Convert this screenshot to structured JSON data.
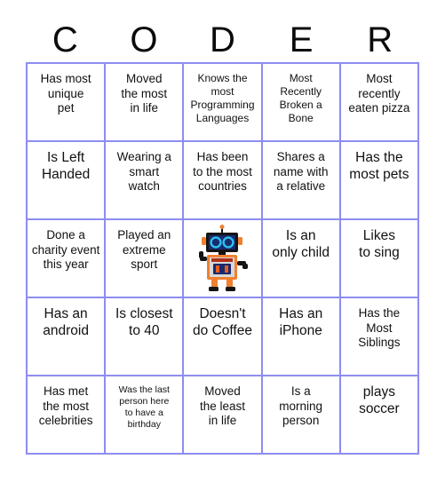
{
  "header": {
    "letters": [
      "C",
      "O",
      "D",
      "E",
      "R"
    ]
  },
  "grid": {
    "border_color": "#8d8df2",
    "rows": 5,
    "columns": 5,
    "cells": [
      {
        "text": "Has most\nunique\npet",
        "size": "md"
      },
      {
        "text": "Moved\nthe most\nin life",
        "size": "md"
      },
      {
        "text": "Knows the\nmost\nProgramming\nLanguages",
        "size": "sm"
      },
      {
        "text": "Most\nRecently\nBroken a\nBone",
        "size": "sm"
      },
      {
        "text": "Most\nrecently\neaten pizza",
        "size": "md"
      },
      {
        "text": "Is Left\nHanded",
        "size": "lg"
      },
      {
        "text": "Wearing a\nsmart\nwatch",
        "size": "md"
      },
      {
        "text": "Has been\nto the most\ncountries",
        "size": "md"
      },
      {
        "text": "Shares a\nname with\na relative",
        "size": "md"
      },
      {
        "text": "Has the\nmost pets",
        "size": "lg"
      },
      {
        "text": "Done a\ncharity event\nthis year",
        "size": "md"
      },
      {
        "text": "Played an\nextreme\nsport",
        "size": "md"
      },
      {
        "text": "",
        "size": "md",
        "icon": "robot-free-space-icon"
      },
      {
        "text": "Is an\nonly child",
        "size": "lg"
      },
      {
        "text": "Likes\nto sing",
        "size": "lg"
      },
      {
        "text": "Has an\nandroid",
        "size": "lg"
      },
      {
        "text": "Is closest\nto 40",
        "size": "lg"
      },
      {
        "text": "Doesn't\ndo Coffee",
        "size": "lg"
      },
      {
        "text": "Has an\niPhone",
        "size": "lg"
      },
      {
        "text": "Has the\nMost\nSiblings",
        "size": "md"
      },
      {
        "text": "Has met\nthe most\ncelebrities",
        "size": "md"
      },
      {
        "text": "Was the last\nperson here\nto have a\nbirthday",
        "size": "xs"
      },
      {
        "text": "Moved\nthe least\nin life",
        "size": "md"
      },
      {
        "text": "Is a\nmorning\nperson",
        "size": "md"
      },
      {
        "text": "plays\nsoccer",
        "size": "lg"
      }
    ]
  },
  "free_space": {
    "icon": "robot-free-space-icon",
    "colors": {
      "body": "#f08030",
      "screen": "#1a2a6e",
      "eye": "#29c2f0",
      "panel": "#d8d8d8",
      "dark": "#141414"
    }
  }
}
